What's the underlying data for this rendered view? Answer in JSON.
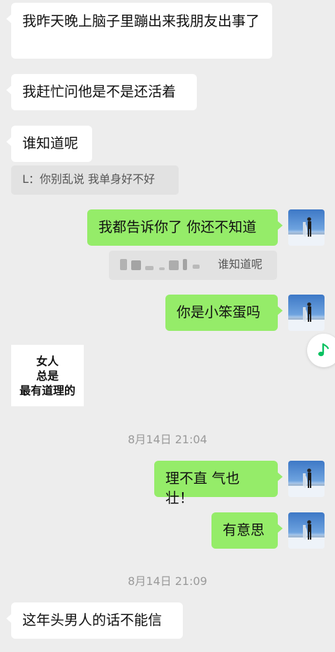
{
  "messages": [
    {
      "text": "我昨天晚上脑子里蹦出来我朋友出事了"
    },
    {
      "text": "我赶忙问他是不是还活着"
    },
    {
      "text": "谁知道呢"
    },
    {
      "quote_sender": "L：",
      "quote_text": "你别乱说 我单身好不好"
    },
    {
      "text": "我都告诉你了 你还不知道"
    },
    {
      "quote_text": "谁知道呢"
    },
    {
      "text": "你是小笨蛋吗"
    },
    {
      "sticker_lines": [
        "女人",
        "总是",
        "最有道理的"
      ]
    },
    {
      "timestamp": "8月14日 21:04"
    },
    {
      "text": "理不直 气也壮！"
    },
    {
      "text": "有意思"
    },
    {
      "timestamp": "8月14日 21:09"
    },
    {
      "text": "这年头男人的话不能信"
    }
  ],
  "icons": {
    "music": "music-note-icon",
    "avatar": "avatar-snow-person"
  },
  "colors": {
    "background": "#ededed",
    "incoming_bubble": "#ffffff",
    "outgoing_bubble": "#95ec69",
    "quote_bg": "#e2e2e2",
    "music_icon": "#07c160"
  }
}
